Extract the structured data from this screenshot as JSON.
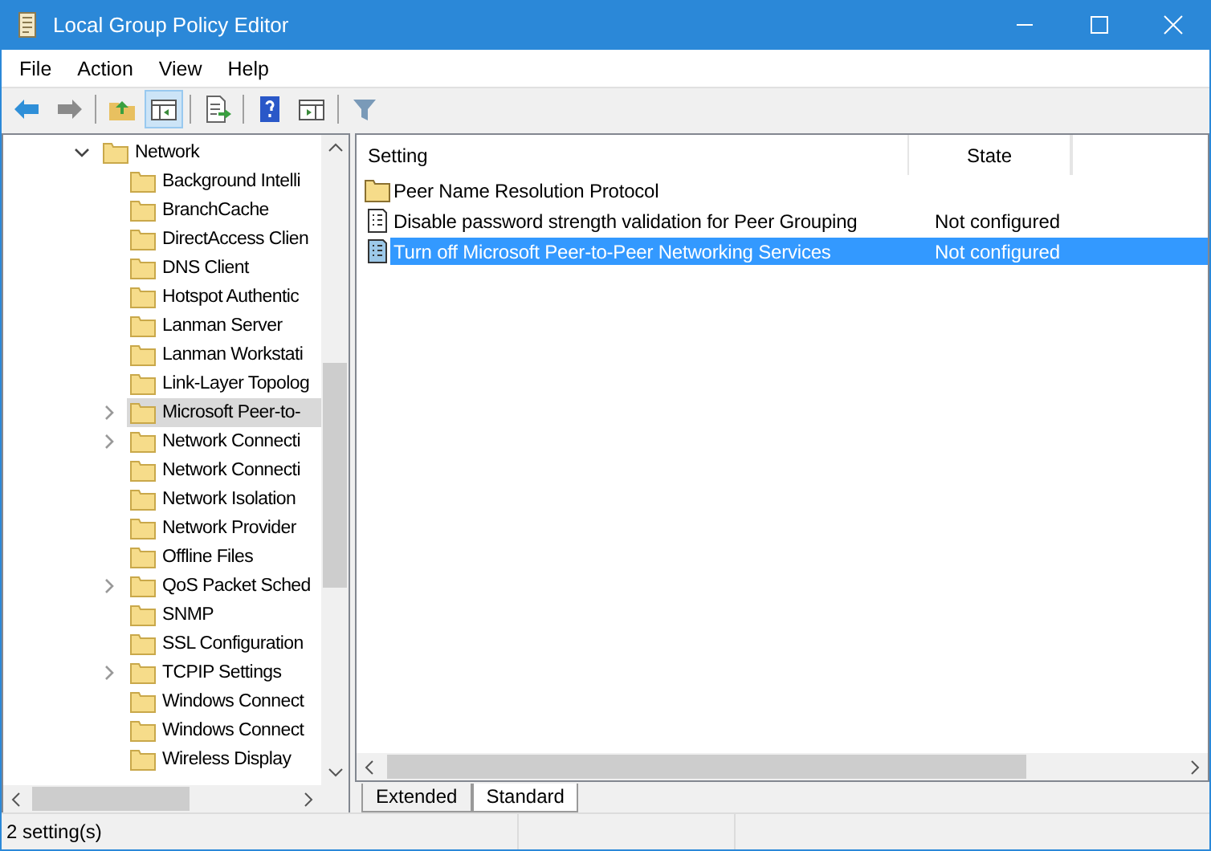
{
  "window": {
    "title": "Local Group Policy Editor"
  },
  "menu": [
    "File",
    "Action",
    "View",
    "Help"
  ],
  "toolbar": [
    {
      "kind": "back"
    },
    {
      "kind": "forward"
    },
    {
      "kind": "sep"
    },
    {
      "kind": "up"
    },
    {
      "kind": "tree",
      "pressed": true
    },
    {
      "kind": "sep"
    },
    {
      "kind": "export"
    },
    {
      "kind": "sep"
    },
    {
      "kind": "help"
    },
    {
      "kind": "view"
    },
    {
      "kind": "sep"
    },
    {
      "kind": "filter"
    }
  ],
  "tree": {
    "label": "Network",
    "expanded": true,
    "children": [
      {
        "label": "Background Intelli",
        "expandable": false,
        "selected": false
      },
      {
        "label": "BranchCache",
        "expandable": false,
        "selected": false
      },
      {
        "label": "DirectAccess Clien",
        "expandable": false,
        "selected": false
      },
      {
        "label": "DNS Client",
        "expandable": false,
        "selected": false
      },
      {
        "label": "Hotspot Authentic",
        "expandable": false,
        "selected": false
      },
      {
        "label": "Lanman Server",
        "expandable": false,
        "selected": false
      },
      {
        "label": "Lanman Workstati",
        "expandable": false,
        "selected": false
      },
      {
        "label": "Link-Layer Topolog",
        "expandable": false,
        "selected": false
      },
      {
        "label": "Microsoft Peer-to-",
        "expandable": true,
        "selected": true
      },
      {
        "label": "Network Connecti",
        "expandable": true,
        "selected": false
      },
      {
        "label": "Network Connecti",
        "expandable": false,
        "selected": false
      },
      {
        "label": "Network Isolation",
        "expandable": false,
        "selected": false
      },
      {
        "label": "Network Provider",
        "expandable": false,
        "selected": false
      },
      {
        "label": "Offline Files",
        "expandable": false,
        "selected": false
      },
      {
        "label": "QoS Packet Sched",
        "expandable": true,
        "selected": false
      },
      {
        "label": "SNMP",
        "expandable": false,
        "selected": false
      },
      {
        "label": "SSL Configuration",
        "expandable": false,
        "selected": false
      },
      {
        "label": "TCPIP Settings",
        "expandable": true,
        "selected": false
      },
      {
        "label": "Windows Connect",
        "expandable": false,
        "selected": false
      },
      {
        "label": "Windows Connect",
        "expandable": false,
        "selected": false
      },
      {
        "label": "Wireless Display",
        "expandable": false,
        "selected": false
      }
    ]
  },
  "table": {
    "columns": [
      "Setting",
      "State"
    ],
    "rows": [
      {
        "kind": "folder",
        "setting": "Peer Name Resolution Protocol",
        "selected": false
      },
      {
        "kind": "policy",
        "setting": "Disable password strength validation for Peer Grouping",
        "state": "Not configured",
        "selected": false
      },
      {
        "kind": "policy",
        "setting": "Turn off Microsoft Peer-to-Peer Networking Services",
        "state": "Not configured",
        "selected": true
      }
    ]
  },
  "tabs": [
    {
      "label": "Extended",
      "selected": false
    },
    {
      "label": "Standard",
      "selected": true
    }
  ],
  "status_bar": "2 setting(s)"
}
